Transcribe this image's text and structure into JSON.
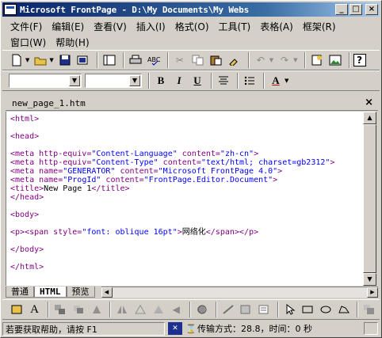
{
  "window": {
    "title": "Microsoft FrontPage - D:\\My Documents\\My Webs",
    "minimize_label": "_",
    "maximize_label": "□",
    "close_label": "×"
  },
  "menu": {
    "row1": [
      "文件(F)",
      "编辑(E)",
      "查看(V)",
      "插入(I)",
      "格式(O)",
      "工具(T)",
      "表格(A)",
      "框架(R)"
    ],
    "row2": [
      "窗口(W)",
      "帮助(H)"
    ]
  },
  "standard_toolbar": {
    "icons": [
      "new-icon",
      "open-icon",
      "save-icon",
      "publish-icon",
      "folder-list-icon",
      "print-icon",
      "spelling-icon",
      "cut-icon",
      "copy-icon",
      "paste-icon",
      "format-painter-icon",
      "undo-icon",
      "redo-icon",
      "web-component-icon",
      "insert-picture-icon",
      "help-icon"
    ]
  },
  "format_toolbar": {
    "style_value": "",
    "font_value": "",
    "bold_label": "B",
    "italic_label": "I",
    "underline_label": "U",
    "font_color_label": "A"
  },
  "document": {
    "tab_label": "new_page_1.htm",
    "close_label": "×"
  },
  "code": {
    "html_open": "<html>",
    "head_open": "<head>",
    "meta1": {
      "pre": "<meta http-equiv=",
      "val1": "\"Content-Language\"",
      "mid": " content=",
      "val2": "\"zh-cn\"",
      "end": ">"
    },
    "meta2": {
      "pre": "<meta http-equiv=",
      "val1": "\"Content-Type\"",
      "mid": " content=",
      "val2": "\"text/html; charset=gb2312\"",
      "end": ">"
    },
    "meta3": {
      "pre": "<meta name=",
      "val1": "\"GENERATOR\"",
      "mid": " content=",
      "val2": "\"Microsoft FrontPage 4.0\"",
      "end": ">"
    },
    "meta4": {
      "pre": "<meta name=",
      "val1": "\"ProgId\"",
      "mid": " content=",
      "val2": "\"FrontPage.Editor.Document\"",
      "end": ">"
    },
    "title_open": "<title>",
    "title_text": "New Page 1",
    "title_close": "</title>",
    "head_close": "</head>",
    "body_open": "<body>",
    "p_open": "<p>",
    "span_pre": "<span style=",
    "span_val": "\"font: oblique 16pt\"",
    "span_end": ">",
    "span_text": "网络化",
    "span_close": "</span>",
    "p_close": "</p>",
    "body_close": "</body>",
    "html_close": "</html>"
  },
  "view_tabs": [
    "普通",
    "HTML",
    "预览"
  ],
  "drawing_toolbar": {
    "icons": [
      "draw-icon",
      "wordart-icon",
      "group-icon",
      "order-icon",
      "rotate-icon",
      "flip-icon",
      "align-icon",
      "shadow-icon",
      "line-icon",
      "fill-icon",
      "select-icon",
      "rectangle-icon",
      "oval-icon",
      "freeform-icon",
      "bring-forward-icon"
    ]
  },
  "status": {
    "help_text": "若要获取帮助，请按 F1",
    "transfer_text": "传输方式：28.8，时间：0 秒"
  }
}
